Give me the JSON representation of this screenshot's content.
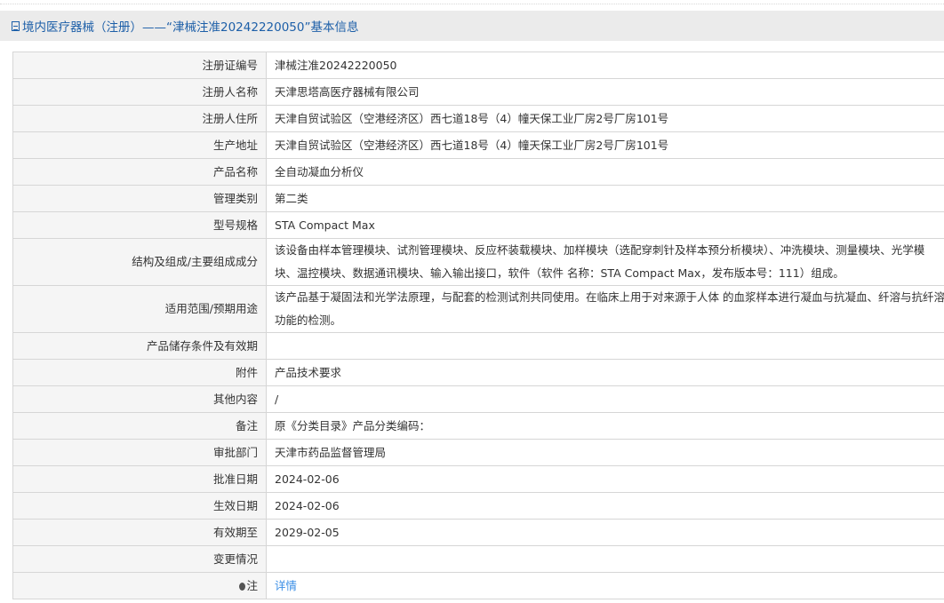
{
  "header": {
    "title": "境内医疗器械（注册）——“津械注准20242220050”基本信息",
    "icon": "document-icon"
  },
  "rows": [
    {
      "label": "注册证编号",
      "value": "津械注准20242220050"
    },
    {
      "label": "注册人名称",
      "value": "天津思塔高医疗器械有限公司"
    },
    {
      "label": "注册人住所",
      "value": "天津自贸试验区（空港经济区）西七道18号（4）幢天保工业厂房2号厂房101号"
    },
    {
      "label": "生产地址",
      "value": "天津自贸试验区（空港经济区）西七道18号（4）幢天保工业厂房2号厂房101号"
    },
    {
      "label": "产品名称",
      "value": "全自动凝血分析仪"
    },
    {
      "label": "管理类别",
      "value": "第二类"
    },
    {
      "label": "型号规格",
      "value": "STA Compact Max"
    },
    {
      "label": "结构及组成/主要组成成分",
      "value": "该设备由样本管理模块、试剂管理模块、反应杯装载模块、加样模块（选配穿刺针及样本预分析模块）、冲洗模块、测量模块、光学模块、温控模块、数据通讯模块、输入输出接口，软件（软件 名称：STA Compact Max，发布版本号：111）组成。"
    },
    {
      "label": "适用范围/预期用途",
      "value": "该产品基于凝固法和光学法原理，与配套的检测试剂共同使用。在临床上用于对来源于人体 的血浆样本进行凝血与抗凝血、纤溶与抗纤溶功能的检测。"
    },
    {
      "label": "产品储存条件及有效期",
      "value": ""
    },
    {
      "label": "附件",
      "value": "产品技术要求"
    },
    {
      "label": "其他内容",
      "value": "/"
    },
    {
      "label": "备注",
      "value": "原《分类目录》产品分类编码："
    },
    {
      "label": "审批部门",
      "value": "天津市药品监督管理局"
    },
    {
      "label": "批准日期",
      "value": "2024-02-06"
    },
    {
      "label": "生效日期",
      "value": "2024-02-06"
    },
    {
      "label": "有效期至",
      "value": "2029-02-05"
    },
    {
      "label": "变更情况",
      "value": ""
    }
  ],
  "note": {
    "label": "注",
    "link": "详情"
  }
}
